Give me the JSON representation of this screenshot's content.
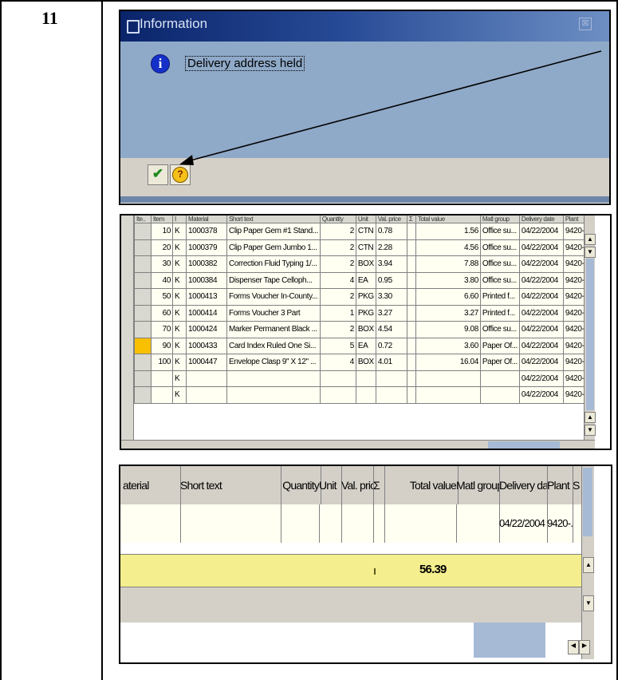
{
  "step_number": "11",
  "dialog": {
    "title": "Information",
    "close_glyph": "⊠",
    "message": "Delivery address held",
    "icons": [
      "info-icon",
      "checkmark-icon",
      "help-icon"
    ]
  },
  "item_table": {
    "headers": [
      "Ite..",
      "Item",
      "I",
      "Material",
      "Short text",
      "Quantity",
      "Unit",
      "Val. price",
      "Σ",
      "Total value",
      "Matl group",
      "Delivery date",
      "Plant"
    ],
    "rows": [
      {
        "item": "10",
        "cat": "K",
        "material": "1000378",
        "text": "Clip Paper Gem #1 Stand...",
        "qty": "2",
        "unit": "CTN",
        "price": "0.78",
        "total": "1.56",
        "group": "Office su...",
        "date": "04/22/2004",
        "plant": "9420-..."
      },
      {
        "item": "20",
        "cat": "K",
        "material": "1000379",
        "text": "Clip Paper Gem Jumbo 1...",
        "qty": "2",
        "unit": "CTN",
        "price": "2.28",
        "total": "4.56",
        "group": "Office su...",
        "date": "04/22/2004",
        "plant": "9420-..."
      },
      {
        "item": "30",
        "cat": "K",
        "material": "1000382",
        "text": "Correction Fluid Typing 1/...",
        "qty": "2",
        "unit": "BOX",
        "price": "3.94",
        "total": "7.88",
        "group": "Office su...",
        "date": "04/22/2004",
        "plant": "9420-..."
      },
      {
        "item": "40",
        "cat": "K",
        "material": "1000384",
        "text": "Dispenser Tape Celloph...",
        "qty": "4",
        "unit": "EA",
        "price": "0.95",
        "total": "3.80",
        "group": "Office su...",
        "date": "04/22/2004",
        "plant": "9420-..."
      },
      {
        "item": "50",
        "cat": "K",
        "material": "1000413",
        "text": "Forms Voucher In-County...",
        "qty": "2",
        "unit": "PKG",
        "price": "3.30",
        "total": "6.60",
        "group": "Printed f...",
        "date": "04/22/2004",
        "plant": "9420-..."
      },
      {
        "item": "60",
        "cat": "K",
        "material": "1000414",
        "text": "Forms Voucher 3 Part",
        "qty": "1",
        "unit": "PKG",
        "price": "3.27",
        "total": "3.27",
        "group": "Printed f...",
        "date": "04/22/2004",
        "plant": "9420-..."
      },
      {
        "item": "70",
        "cat": "K",
        "material": "1000424",
        "text": "Marker Permanent Black ...",
        "qty": "2",
        "unit": "BOX",
        "price": "4.54",
        "total": "9.08",
        "group": "Office su...",
        "date": "04/22/2004",
        "plant": "9420-..."
      },
      {
        "item": "90",
        "cat": "K",
        "material": "1000433",
        "text": "Card Index Ruled One Si...",
        "qty": "5",
        "unit": "EA",
        "price": "0.72",
        "total": "3.60",
        "group": "Paper Of...",
        "date": "04/22/2004",
        "plant": "9420-...",
        "selected": true
      },
      {
        "item": "100",
        "cat": "K",
        "material": "1000447",
        "text": "Envelope Clasp 9\" X 12\" ...",
        "qty": "4",
        "unit": "BOX",
        "price": "4.01",
        "total": "16.04",
        "group": "Paper Of...",
        "date": "04/22/2004",
        "plant": "9420-..."
      },
      {
        "item": "",
        "cat": "K",
        "material": "",
        "text": "",
        "qty": "",
        "unit": "",
        "price": "",
        "total": "",
        "group": "",
        "date": "04/22/2004",
        "plant": "9420-..."
      },
      {
        "item": "",
        "cat": "K",
        "material": "",
        "text": "",
        "qty": "",
        "unit": "",
        "price": "",
        "total": "",
        "group": "",
        "date": "04/22/2004",
        "plant": "9420-..."
      }
    ]
  },
  "totals_panel": {
    "headers": [
      "aterial",
      "Short text",
      "Quantity",
      "Unit",
      "Val. price",
      "Σ",
      "Total value",
      "Matl group",
      "Delivery date",
      "Plant",
      "S"
    ],
    "row_date": "04/22/2004",
    "row_plant": "9420-...",
    "total_value": "56.39"
  },
  "colors": {
    "title_bar": "#0a246a",
    "dialog_body": "#8fa9c8",
    "selected_row": "#f8c000",
    "total_row": "#f4ee8e"
  }
}
